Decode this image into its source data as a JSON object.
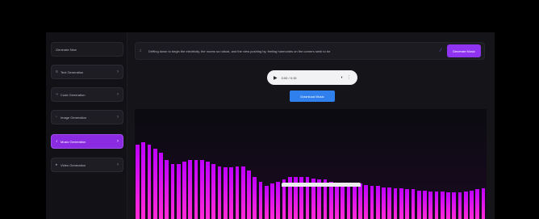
{
  "sidebar": {
    "new_button": "Generate New",
    "items": [
      {
        "label": "Text Generation",
        "icon": "chevron-right-icon",
        "active": false
      },
      {
        "label": "Code Generation",
        "icon": "chevron-right-icon",
        "active": false
      },
      {
        "label": "Image Generation",
        "icon": "chevron-right-icon",
        "active": false
      },
      {
        "label": "Music Generation",
        "icon": "chevron-right-icon",
        "active": true
      },
      {
        "label": "Video Generation",
        "icon": "chevron-right-icon",
        "active": false
      }
    ]
  },
  "prompt": {
    "icon": "music-note-icon",
    "text": "Drifting down to begin the electricity, the rooms so robust, and the view pushing by, feeling harmonies on the corners seek to be",
    "wand_icon": "magic-wand-icon",
    "generate_label": "Generate Music"
  },
  "player": {
    "time": "0:00 / 0:15",
    "progress": 0.0,
    "play_icon": "play-icon",
    "volume_icon": "volume-icon",
    "more_icon": "more-options-icon"
  },
  "download_label": "Download Music",
  "visualizer": {
    "levels": [
      0.68,
      0.7,
      0.68,
      0.64,
      0.6,
      0.54,
      0.5,
      0.5,
      0.52,
      0.54,
      0.54,
      0.54,
      0.52,
      0.5,
      0.48,
      0.47,
      0.47,
      0.48,
      0.48,
      0.44,
      0.38,
      0.34,
      0.3,
      0.32,
      0.34,
      0.36,
      0.38,
      0.38,
      0.38,
      0.38,
      0.37,
      0.36,
      0.36,
      0.34,
      0.33,
      0.33,
      0.32,
      0.32,
      0.32,
      0.31,
      0.3,
      0.3,
      0.29,
      0.29,
      0.28,
      0.28,
      0.27,
      0.27,
      0.26,
      0.26,
      0.25,
      0.25,
      0.25,
      0.24,
      0.24,
      0.24,
      0.25,
      0.26,
      0.27,
      0.28
    ],
    "color_top": "#c000ff",
    "color_bottom": "#ff2bd6",
    "color_bg": "#1a0a22"
  }
}
